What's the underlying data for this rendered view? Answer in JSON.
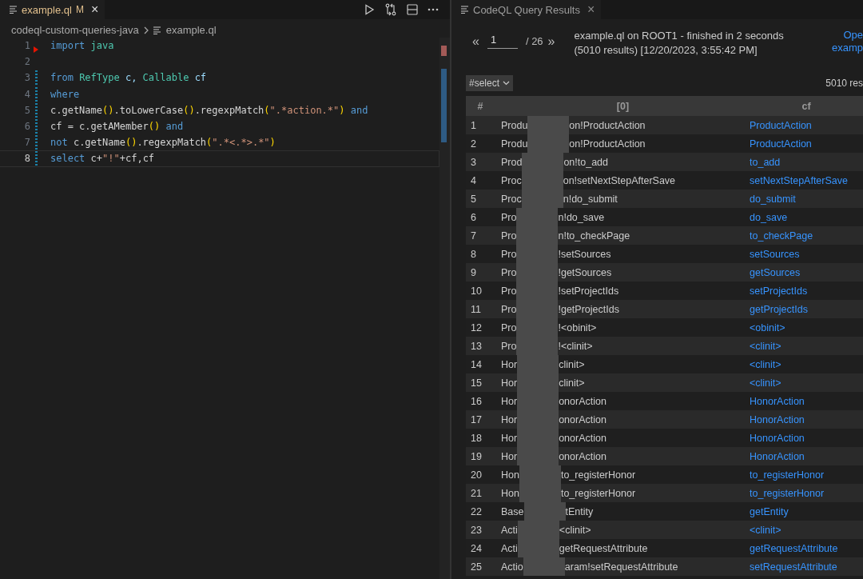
{
  "editor": {
    "tab": {
      "title": "example.ql",
      "badge": "M",
      "close": "×"
    },
    "breadcrumb": [
      "codeql-custom-queries-java",
      "example.ql"
    ],
    "lines": [
      {
        "n": "1",
        "current": false,
        "changed": false,
        "tokens": [
          {
            "kind": "kw",
            "t": "import"
          },
          {
            "kind": "type",
            "t": " java"
          }
        ]
      },
      {
        "n": "2",
        "current": false,
        "changed": false
      },
      {
        "n": "3",
        "current": false,
        "changed": true,
        "tokens": [
          {
            "kind": "kw",
            "t": "from"
          },
          {
            "kind": "type",
            "t": " RefType"
          },
          {
            "kind": "var",
            "t": " c, "
          },
          {
            "kind": "type",
            "t": "Callable"
          },
          {
            "kind": "var",
            "t": " cf"
          }
        ]
      },
      {
        "n": "4",
        "current": false,
        "changed": true,
        "tokens": [
          {
            "kind": "kw",
            "t": "where"
          }
        ]
      },
      {
        "n": "5",
        "current": false,
        "changed": true,
        "tokens": [
          {
            "kind": "plain",
            "t": "c.getName"
          },
          {
            "kind": "paren",
            "t": "()"
          },
          {
            "kind": "plain",
            "t": ".toLowerCase"
          },
          {
            "kind": "paren",
            "t": "()"
          },
          {
            "kind": "plain",
            "t": ".regexpMatch"
          },
          {
            "kind": "paren",
            "t": "("
          },
          {
            "kind": "str",
            "t": "\".*action.*\""
          },
          {
            "kind": "paren",
            "t": ")"
          },
          {
            "kind": "kw",
            "t": " and"
          }
        ]
      },
      {
        "n": "6",
        "current": false,
        "changed": true,
        "tokens": [
          {
            "kind": "plain",
            "t": "cf = c.getAMember"
          },
          {
            "kind": "paren",
            "t": "()"
          },
          {
            "kind": "kw",
            "t": " and"
          }
        ]
      },
      {
        "n": "7",
        "current": false,
        "changed": true,
        "tokens": [
          {
            "kind": "kw",
            "t": "not"
          },
          {
            "kind": "plain",
            "t": " c.getName"
          },
          {
            "kind": "paren",
            "t": "()"
          },
          {
            "kind": "plain",
            "t": ".regexpMatch"
          },
          {
            "kind": "paren",
            "t": "("
          },
          {
            "kind": "str",
            "t": "\".*<.*>.*\""
          },
          {
            "kind": "paren",
            "t": ")"
          }
        ]
      },
      {
        "n": "8",
        "current": true,
        "changed": true,
        "tokens": [
          {
            "kind": "kw",
            "t": "select"
          },
          {
            "kind": "plain",
            "t": " c+"
          },
          {
            "kind": "str",
            "t": "\"!\""
          },
          {
            "kind": "plain",
            "t": "+cf,cf"
          }
        ]
      }
    ]
  },
  "results": {
    "tab": {
      "title": "CodeQL Query Results",
      "close": "×"
    },
    "pager": {
      "prev": "«",
      "page": "1",
      "total": "/ 26",
      "next": "»"
    },
    "summary": "example.ql on ROOT1 - finished in 2 seconds (5010 results) [12/20/2023, 3:55:42 PM]",
    "open_link": [
      "Ope",
      "examp"
    ],
    "result_set": "#select",
    "count": "5010 res",
    "columns": [
      "#",
      "[0]",
      "cf"
    ],
    "rows": [
      {
        "n": "1",
        "col0_start": "Produ",
        "col0_end": "on!ProductAction",
        "cf": "ProductAction"
      },
      {
        "n": "2",
        "col0_start": "Produ",
        "col0_end": "on!ProductAction",
        "cf": "ProductAction"
      },
      {
        "n": "3",
        "col0_start": "Prod",
        "col0_end": "on!to_add",
        "cf": "to_add"
      },
      {
        "n": "4",
        "col0_start": "Proc",
        "col0_end": "on!setNextStepAfterSave",
        "cf": "setNextStepAfterSave"
      },
      {
        "n": "5",
        "col0_start": "Proc",
        "col0_end": "n!do_submit",
        "cf": "do_submit"
      },
      {
        "n": "6",
        "col0_start": "Pro",
        "col0_end": "n!do_save",
        "cf": "do_save"
      },
      {
        "n": "7",
        "col0_start": "Pro",
        "col0_end": "n!to_checkPage",
        "cf": "to_checkPage"
      },
      {
        "n": "8",
        "col0_start": "Pro",
        "col0_end": "!setSources",
        "cf": "setSources"
      },
      {
        "n": "9",
        "col0_start": "Pro",
        "col0_end": "!getSources",
        "cf": "getSources"
      },
      {
        "n": "10",
        "col0_start": "Pro",
        "col0_end": "!setProjectIds",
        "cf": "setProjectIds"
      },
      {
        "n": "11",
        "col0_start": "Pro",
        "col0_end": "!getProjectIds",
        "cf": "getProjectIds"
      },
      {
        "n": "12",
        "col0_start": "Pro",
        "col0_end": "!<obinit>",
        "cf": "<obinit>"
      },
      {
        "n": "13",
        "col0_start": "Pro",
        "col0_end": "!<clinit>",
        "cf": "<clinit>"
      },
      {
        "n": "14",
        "col0_start": "Hor",
        "col0_end": "clinit>",
        "cf": "<clinit>"
      },
      {
        "n": "15",
        "col0_start": "Hor",
        "col0_end": "clinit>",
        "cf": "<clinit>"
      },
      {
        "n": "16",
        "col0_start": "Hor",
        "col0_end": "onorAction",
        "cf": "HonorAction"
      },
      {
        "n": "17",
        "col0_start": "Hor",
        "col0_end": "onorAction",
        "cf": "HonorAction"
      },
      {
        "n": "18",
        "col0_start": "Hor",
        "col0_end": "onorAction",
        "cf": "HonorAction"
      },
      {
        "n": "19",
        "col0_start": "Hor",
        "col0_end": "onorAction",
        "cf": "HonorAction"
      },
      {
        "n": "20",
        "col0_start": "Hon",
        "col0_end": "to_registerHonor",
        "cf": "to_registerHonor"
      },
      {
        "n": "21",
        "col0_start": "Hon",
        "col0_end": "to_registerHonor",
        "cf": "to_registerHonor"
      },
      {
        "n": "22",
        "col0_start": "Base",
        "col0_end": "tEntity",
        "cf": "getEntity"
      },
      {
        "n": "23",
        "col0_start": "Acti",
        "col0_end": "<clinit>",
        "cf": "<clinit>"
      },
      {
        "n": "24",
        "col0_start": "Acti",
        "col0_end": "getRequestAttribute",
        "cf": "getRequestAttribute"
      },
      {
        "n": "25",
        "col0_start": "Actio",
        "col0_end": "aram!setRequestAttribute",
        "cf": "setRequestAttribute"
      }
    ]
  }
}
